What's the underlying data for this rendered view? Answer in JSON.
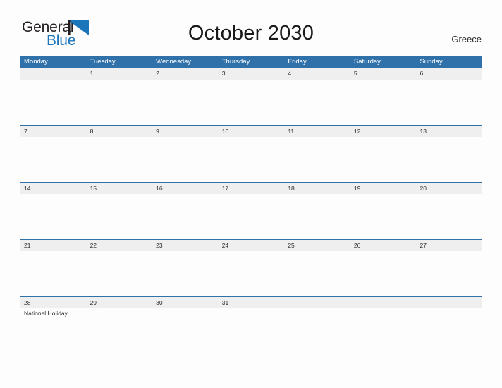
{
  "brand": {
    "name_part1": "General",
    "name_part2": "Blue",
    "flag_icon": "blue-triangle-flag-icon",
    "color_dark": "#231f20",
    "color_blue": "#1b75bb"
  },
  "header": {
    "title": "October 2030",
    "country": "Greece"
  },
  "theme": {
    "header_blue": "#3071a9",
    "row_band_gray": "#efefef",
    "page_background": "#fdfdfd",
    "text_dark": "#2b2b2b"
  },
  "calendar": {
    "month": "October",
    "year": "2030",
    "weekday_headers": [
      "Monday",
      "Tuesday",
      "Wednesday",
      "Thursday",
      "Friday",
      "Saturday",
      "Sunday"
    ],
    "weeks": [
      {
        "days": [
          {
            "date": "",
            "events": []
          },
          {
            "date": "1",
            "events": []
          },
          {
            "date": "2",
            "events": []
          },
          {
            "date": "3",
            "events": []
          },
          {
            "date": "4",
            "events": []
          },
          {
            "date": "5",
            "events": []
          },
          {
            "date": "6",
            "events": []
          }
        ]
      },
      {
        "days": [
          {
            "date": "7",
            "events": []
          },
          {
            "date": "8",
            "events": []
          },
          {
            "date": "9",
            "events": []
          },
          {
            "date": "10",
            "events": []
          },
          {
            "date": "11",
            "events": []
          },
          {
            "date": "12",
            "events": []
          },
          {
            "date": "13",
            "events": []
          }
        ]
      },
      {
        "days": [
          {
            "date": "14",
            "events": []
          },
          {
            "date": "15",
            "events": []
          },
          {
            "date": "16",
            "events": []
          },
          {
            "date": "17",
            "events": []
          },
          {
            "date": "18",
            "events": []
          },
          {
            "date": "19",
            "events": []
          },
          {
            "date": "20",
            "events": []
          }
        ]
      },
      {
        "days": [
          {
            "date": "21",
            "events": []
          },
          {
            "date": "22",
            "events": []
          },
          {
            "date": "23",
            "events": []
          },
          {
            "date": "24",
            "events": []
          },
          {
            "date": "25",
            "events": []
          },
          {
            "date": "26",
            "events": []
          },
          {
            "date": "27",
            "events": []
          }
        ]
      },
      {
        "days": [
          {
            "date": "28",
            "events": [
              "National Holiday"
            ]
          },
          {
            "date": "29",
            "events": []
          },
          {
            "date": "30",
            "events": []
          },
          {
            "date": "31",
            "events": []
          },
          {
            "date": "",
            "events": []
          },
          {
            "date": "",
            "events": []
          },
          {
            "date": "",
            "events": []
          }
        ]
      }
    ]
  }
}
